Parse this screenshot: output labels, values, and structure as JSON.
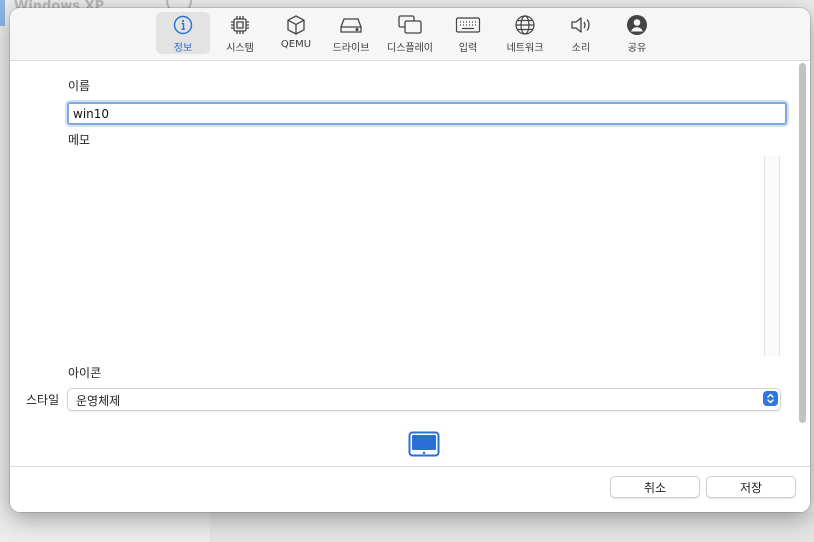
{
  "background": {
    "title": "Windows XP"
  },
  "toolbar": {
    "items": [
      {
        "label": "정보",
        "icon": "info-icon",
        "active": true
      },
      {
        "label": "시스템",
        "icon": "cpu-icon"
      },
      {
        "label": "QEMU",
        "icon": "cube-icon"
      },
      {
        "label": "드라이브",
        "icon": "drive-icon"
      },
      {
        "label": "디스플레이",
        "icon": "display-icon"
      },
      {
        "label": "입력",
        "icon": "keyboard-icon"
      },
      {
        "label": "네트워크",
        "icon": "globe-icon"
      },
      {
        "label": "소리",
        "icon": "speaker-icon"
      },
      {
        "label": "공유",
        "icon": "person-icon"
      }
    ]
  },
  "form": {
    "name_label": "이름",
    "name_value": "win10",
    "memo_label": "메모",
    "memo_value": "",
    "icon_label": "아이콘",
    "style_label": "스타일",
    "style_value": "운영체제"
  },
  "footer": {
    "cancel_label": "취소",
    "save_label": "저장"
  },
  "colors": {
    "accent": "#2a6fd6",
    "select_button": "#2b78e4"
  }
}
